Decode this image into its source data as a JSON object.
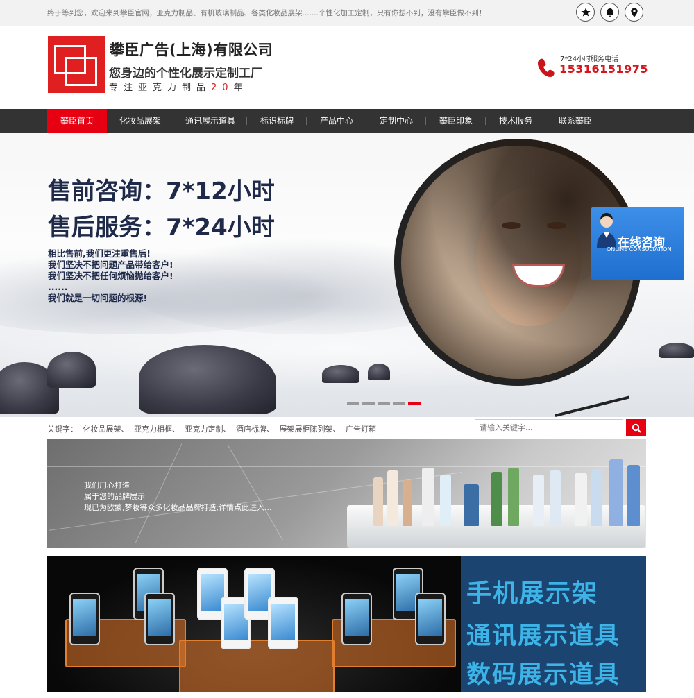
{
  "topbar": {
    "welcome": "终于等到您，欢迎来到攀臣官网，亚克力制品、有机玻璃制品、各类化妆品展架.......个性化加工定制，只有你想不到，没有攀臣做不到！",
    "icons": [
      "star-icon",
      "bell-icon",
      "location-pin-icon"
    ]
  },
  "header": {
    "company": "攀臣广告(上海)有限公司",
    "slogan": "您身边的个性化展示定制工厂",
    "since_prefix": "专注亚克力制品",
    "since_num": "20",
    "since_suffix": "年",
    "hotline_label": "7*24小时服务电话",
    "hotline": "15316151975"
  },
  "nav": {
    "items": [
      "攀臣首页",
      "化妆品展架",
      "通讯展示道具",
      "标识标牌",
      "产品中心",
      "定制中心",
      "攀臣印象",
      "技术服务",
      "联系攀臣"
    ],
    "active_index": 0
  },
  "banner": {
    "line1": "售前咨询：7*12小时",
    "line2": "售后服务：7*24小时",
    "lines": [
      "相比售前,我们更注重售后!",
      "我们坚决不把问题产品带给客户!",
      "我们坚决不把任何烦恼抛给客户!",
      "......",
      "我们就是一切问题的根源!"
    ],
    "slides": 5,
    "active_slide": 4
  },
  "consult": {
    "title": "在线咨询",
    "subtitle": "ONLINE CONSULTATION"
  },
  "keywords": {
    "label": "关键字：",
    "items": [
      "化妆品展架、",
      "亚克力相框、",
      "亚克力定制、",
      "酒店标牌、",
      "展架展柜陈列架、",
      "广告灯箱"
    ]
  },
  "search": {
    "placeholder": "请输入关键字..."
  },
  "card1": {
    "lines": [
      "我们用心打造",
      "属于您的品牌展示",
      "现已为欧蒙,梦妆等众多化妆品品牌打造,详情点此进入..."
    ]
  },
  "card2": {
    "line1": "手机展示架",
    "line2": "通讯展示道具",
    "line3": "数码展示道具"
  },
  "colors": {
    "accent": "#e60012",
    "nav_bg": "#333333",
    "hotline": "#d6141a",
    "consult_bg": "#1f6fd0"
  }
}
